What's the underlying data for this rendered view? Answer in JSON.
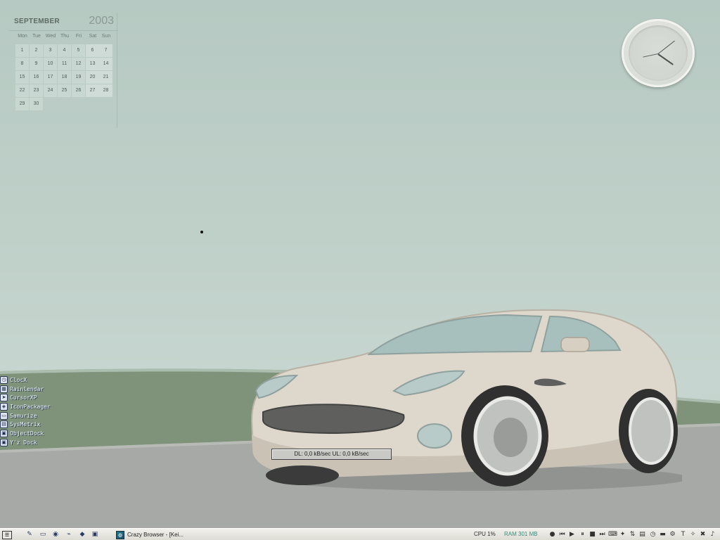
{
  "calendar": {
    "month": "SEPTEMBER",
    "year": "2003",
    "weekdays": [
      "Mon",
      "Tue",
      "Wed",
      "Thu",
      "Fri",
      "Sat",
      "Sun"
    ],
    "weeks": [
      [
        "1",
        "2",
        "3",
        "4",
        "5",
        "6",
        "7"
      ],
      [
        "8",
        "9",
        "10",
        "11",
        "12",
        "13",
        "14"
      ],
      [
        "15",
        "16",
        "17",
        "18",
        "19",
        "20",
        "21"
      ],
      [
        "22",
        "23",
        "24",
        "25",
        "26",
        "27",
        "28"
      ],
      [
        "29",
        "30",
        "",
        "",
        "",
        "",
        ""
      ]
    ]
  },
  "launcher": {
    "items": [
      {
        "label": "ClocX",
        "icon": "clock-icon"
      },
      {
        "label": "Rainlendar",
        "icon": "calendar-icon"
      },
      {
        "label": "CursorXP",
        "icon": "cursor-icon"
      },
      {
        "label": "IconPackager",
        "icon": "package-icon"
      },
      {
        "label": "Samurize",
        "icon": "monitor-icon"
      },
      {
        "label": "SysMetrix",
        "icon": "meter-icon"
      },
      {
        "label": "ObjectDock",
        "icon": "dock-icon"
      },
      {
        "label": "Y'z Dock",
        "icon": "dock-icon"
      }
    ]
  },
  "net_meter": {
    "text": "DL: 0,0 kB/sec  UL: 0,0 kB/sec"
  },
  "taskbar": {
    "task_label": "Crazy Browser - [Kei...",
    "cpu": "CPU 1%",
    "ram": "RAM 301 MB",
    "colors": {
      "cpu": "#2b2b2b",
      "ram": "#3b8a7a"
    }
  }
}
